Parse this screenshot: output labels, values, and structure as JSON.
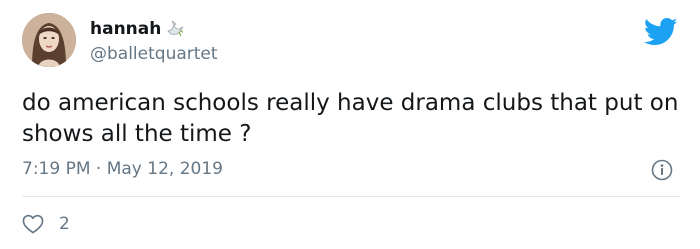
{
  "tweet": {
    "display_name": "hannah",
    "name_emoji": "dove-emoji-icon",
    "handle": "@balletquartet",
    "text": "do american schools really have drama clubs that put on shows all the time ?",
    "timestamp": "7:19 PM · May 12, 2019",
    "like_count": "2"
  },
  "icons": {
    "brand": "twitter-bird-icon",
    "info": "info-icon",
    "like": "heart-icon"
  },
  "colors": {
    "brand": "#1da1f2",
    "text": "#14171a",
    "secondary": "#657786",
    "divider": "#e1e8ed"
  }
}
